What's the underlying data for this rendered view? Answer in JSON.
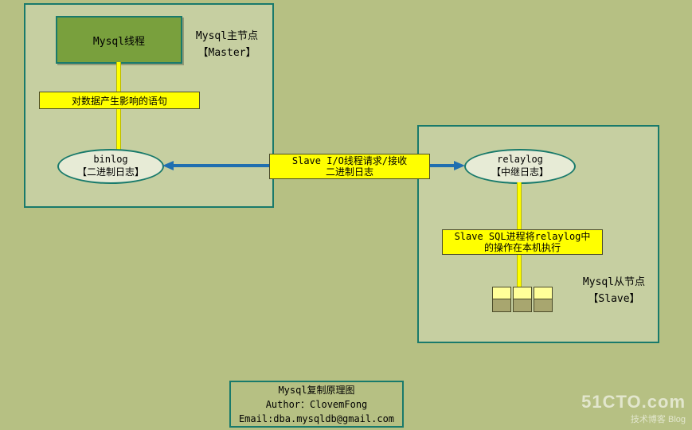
{
  "master": {
    "title_line1": "Mysql主节点",
    "title_line2": "【Master】",
    "thread_label": "Mysql线程",
    "stmt_label": "对数据产生影响的语句",
    "binlog_line1": "binlog",
    "binlog_line2": "【二进制日志】"
  },
  "transport": {
    "label": "Slave I/O线程请求/接收\n二进制日志"
  },
  "slave": {
    "title_line1": "Mysql从节点",
    "title_line2": "【Slave】",
    "relaylog_line1": "relaylog",
    "relaylog_line2": "【中继日志】",
    "sql_label": "Slave SQL进程将relaylog中\n的操作在本机执行"
  },
  "footer": {
    "title": "Mysql复制原理图",
    "author": "Author：ClovemFong",
    "email": "Email:dba.mysqldb@gmail.com"
  },
  "watermark": {
    "logo": "51CTO.com",
    "sub": "技术博客    Blog"
  }
}
